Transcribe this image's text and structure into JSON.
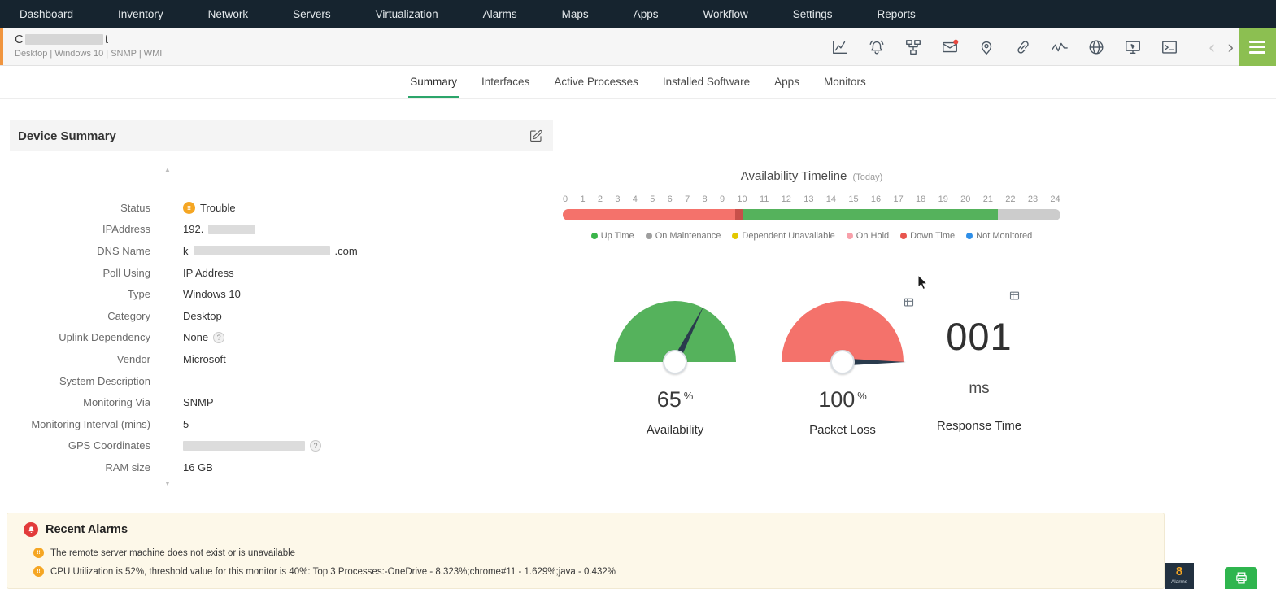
{
  "colors": {
    "nav_bg": "#16242f",
    "accent_green": "#2ba56a",
    "status_trouble_orange": "#f5a623",
    "status_accent_strip": "#f0953f",
    "alarm_red": "#e23b3b",
    "hamburger_green": "#8cbf51"
  },
  "nav": {
    "items": [
      "Dashboard",
      "Inventory",
      "Network",
      "Servers",
      "Virtualization",
      "Alarms",
      "Maps",
      "Apps",
      "Workflow",
      "Settings",
      "Reports"
    ]
  },
  "device_header": {
    "name_prefix": "C",
    "name_suffix": "t",
    "subtitle": "Desktop | Windows 10 | SNMP  | WMI",
    "toolbar_icons": [
      "performance-chart-icon",
      "alarm-bell-icon",
      "topology-icon",
      "mail-icon",
      "location-pin-icon",
      "dependency-link-icon",
      "traffic-graph-icon",
      "globe-icon",
      "remote-desktop-icon",
      "terminal-icon"
    ],
    "pager": {
      "prev": "‹",
      "next": "›"
    }
  },
  "tabs": [
    {
      "label": "Summary",
      "active": true
    },
    {
      "label": "Interfaces"
    },
    {
      "label": "Active Processes"
    },
    {
      "label": "Installed Software"
    },
    {
      "label": "Apps"
    },
    {
      "label": "Monitors"
    }
  ],
  "device_summary": {
    "title": "Device Summary",
    "fields": [
      {
        "label": "Status",
        "value": "Trouble"
      },
      {
        "label": "IPAddress",
        "value_prefix": "192."
      },
      {
        "label": "DNS Name",
        "value_prefix": "k",
        "value_suffix": ".com"
      },
      {
        "label": "Poll Using",
        "value": "IP Address"
      },
      {
        "label": "Type",
        "value": "Windows 10"
      },
      {
        "label": "Category",
        "value": "Desktop"
      },
      {
        "label": "Uplink Dependency",
        "value": "None",
        "help_badge": "?"
      },
      {
        "label": "Vendor",
        "value": "Microsoft"
      },
      {
        "label": "System Description",
        "value": ""
      },
      {
        "label": "Monitoring Via",
        "value": "SNMP"
      },
      {
        "label": "Monitoring Interval (mins)",
        "value": "5"
      },
      {
        "label": "GPS Coordinates",
        "help_badge": "?"
      },
      {
        "label": "RAM size",
        "value": "16 GB"
      }
    ]
  },
  "chart_data": [
    {
      "type": "timeline",
      "title": "Availability Timeline",
      "subtitle": "(Today)",
      "x_ticks": [
        "0",
        "1",
        "2",
        "3",
        "4",
        "5",
        "6",
        "7",
        "8",
        "9",
        "10",
        "11",
        "12",
        "13",
        "14",
        "15",
        "16",
        "17",
        "18",
        "19",
        "20",
        "21",
        "22",
        "23",
        "24"
      ],
      "segments": [
        {
          "status": "Down Time",
          "from_hour": 0,
          "to_hour": 8.3,
          "color": "#f4726b"
        },
        {
          "status": "Down Time dark marker",
          "from_hour": 8.3,
          "to_hour": 8.7,
          "color": "#c8504a"
        },
        {
          "status": "Up Time",
          "from_hour": 8.7,
          "to_hour": 21.0,
          "color": "#55b25c"
        },
        {
          "status": "Future / no data",
          "from_hour": 21.0,
          "to_hour": 24,
          "color": "#cccccc"
        }
      ],
      "legend": [
        {
          "label": "Up Time",
          "color": "#3bb54a"
        },
        {
          "label": "On Maintenance",
          "color": "#9e9e9e"
        },
        {
          "label": "Dependent Unavailable",
          "color": "#e3c800"
        },
        {
          "label": "On Hold",
          "color": "#f8a0aa"
        },
        {
          "label": "Down Time",
          "color": "#e8554e"
        },
        {
          "label": "Not Monitored",
          "color": "#2f8fe8"
        }
      ]
    },
    {
      "type": "gauge",
      "label": "Availability",
      "value": 65,
      "unit": "%",
      "color": "#55b25c",
      "range": [
        0,
        100
      ]
    },
    {
      "type": "gauge",
      "label": "Packet Loss",
      "value": 100,
      "unit": "%",
      "color": "#f4726b",
      "range": [
        0,
        100
      ]
    },
    {
      "type": "number",
      "label": "Response Time",
      "value": "001",
      "unit": "ms"
    }
  ],
  "recent_alarms": {
    "title": "Recent Alarms",
    "items": [
      "The remote server machine does not exist or is unavailable",
      "CPU Utilization is 52%, threshold value for this monitor is 40%: Top 3 Processes:-OneDrive - 8.323%;chrome#11 - 1.629%;java - 0.432%"
    ]
  },
  "footer": {
    "alarm_count": "8",
    "alarm_count_label": "Alarms"
  }
}
